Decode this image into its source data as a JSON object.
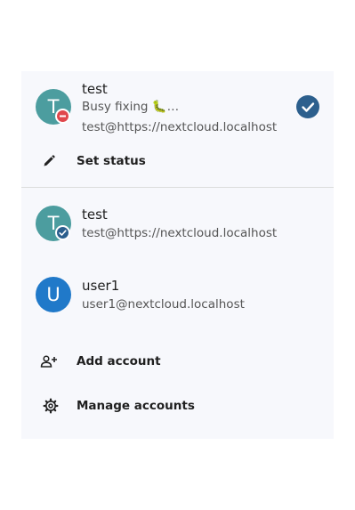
{
  "current_account": {
    "avatar_letter": "T",
    "avatar_color": "#4c9d9f",
    "status_badge_icon": "do-not-disturb-icon",
    "status_badge_color": "#e0474c",
    "name": "test",
    "status_message": "Busy fixing 🐛…",
    "address": "test@https://nextcloud.localhost",
    "selected_icon": "check-circle-icon",
    "accent_color": "#2c5f8d"
  },
  "set_status": {
    "icon": "pencil-icon",
    "label": "Set status"
  },
  "accounts": [
    {
      "avatar_letter": "T",
      "avatar_color": "#4c9d9f",
      "badge_icon": "check-badge-icon",
      "name": "test",
      "address": "test@https://nextcloud.localhost"
    },
    {
      "avatar_letter": "U",
      "avatar_color": "#2079c9",
      "name": "user1",
      "address": "user1@nextcloud.localhost"
    }
  ],
  "actions": {
    "add_account": {
      "icon": "add-person-icon",
      "label": "Add account"
    },
    "manage_accounts": {
      "icon": "gear-icon",
      "label": "Manage accounts"
    }
  }
}
